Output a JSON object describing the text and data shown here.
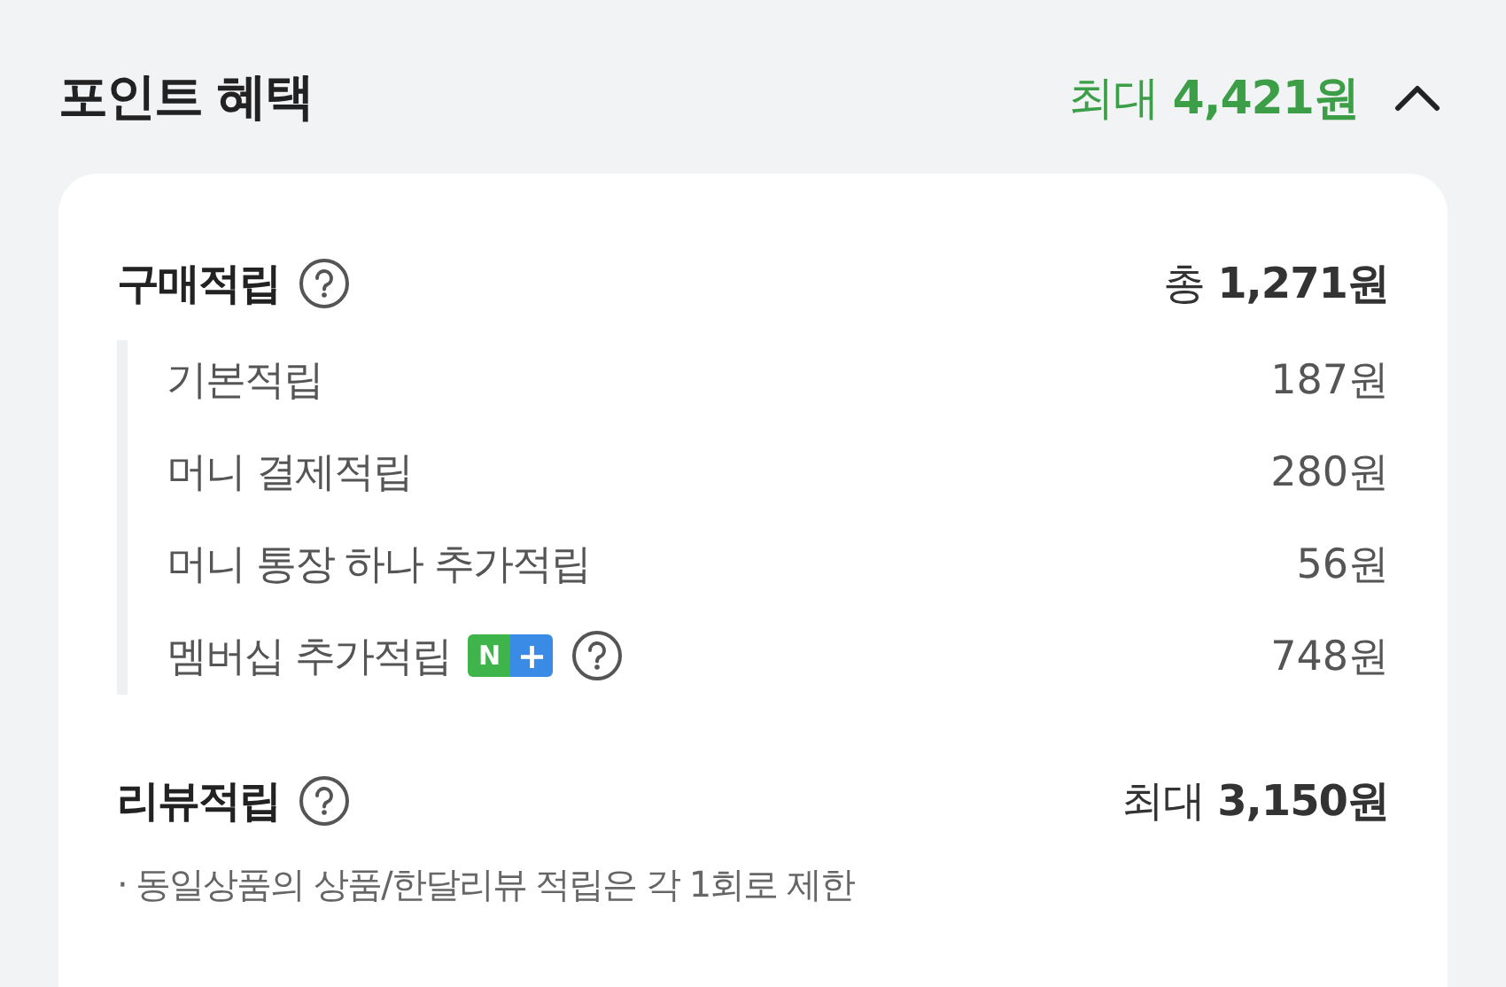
{
  "header": {
    "title": "포인트 혜택",
    "total": "최대 **4,421원**",
    "expanded": true
  },
  "sections": [
    {
      "title": "구매적립",
      "amount": "총 **1,271원**",
      "items": [
        {
          "label": "기본적립",
          "amount": "187원"
        },
        {
          "label": "머니 결제적립",
          "amount": "280원"
        },
        {
          "label": "머니 통장 하나 추가적립",
          "amount": "56원"
        },
        {
          "label": "멤버십 추가적립",
          "amount": "748원",
          "badge": {
            "left": "N",
            "right": "+"
          },
          "help": true
        }
      ]
    },
    {
      "title": "리뷰적립",
      "amount": "최대 **3,150원**",
      "note": "· 동일상품의 상품/한달리뷰 적립은 각 1회로 제한"
    }
  ]
}
